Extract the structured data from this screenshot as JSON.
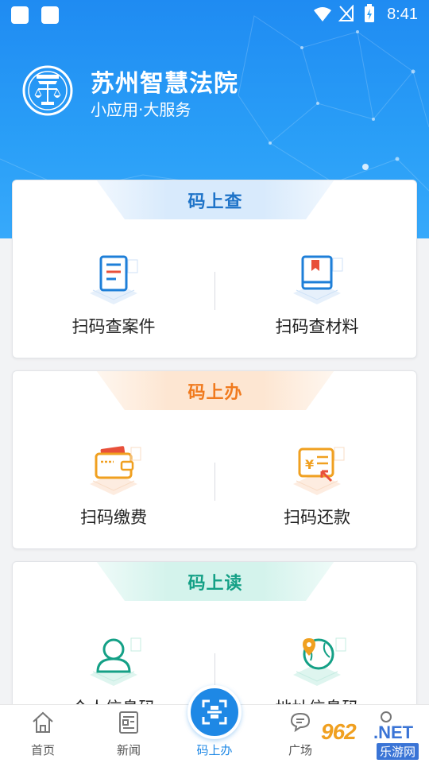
{
  "status_bar": {
    "time": "8:41"
  },
  "header": {
    "title": "苏州智慧法院",
    "subtitle": "小应用·大服务"
  },
  "sections": [
    {
      "title": "码上查",
      "items": [
        {
          "label": "扫码查案件",
          "icon": "document-icon"
        },
        {
          "label": "扫码查材料",
          "icon": "book-icon"
        }
      ]
    },
    {
      "title": "码上办",
      "items": [
        {
          "label": "扫码缴费",
          "icon": "wallet-icon"
        },
        {
          "label": "扫码还款",
          "icon": "yuan-card-icon"
        }
      ]
    },
    {
      "title": "码上读",
      "items": [
        {
          "label": "个人信息码",
          "icon": "person-icon"
        },
        {
          "label": "地址信息码",
          "icon": "globe-location-icon"
        }
      ]
    }
  ],
  "tabbar": {
    "items": [
      {
        "label": "首页",
        "icon": "home-icon"
      },
      {
        "label": "新闻",
        "icon": "news-icon"
      },
      {
        "label": "码上办",
        "icon": "scan-icon"
      },
      {
        "label": "广场",
        "icon": "chat-icon"
      }
    ]
  },
  "watermark": {
    "number": "962",
    "net": ".NET",
    "site": "乐游网"
  },
  "colors": {
    "primary": "#1e88e5",
    "blue_title": "#1e73c8",
    "orange_title": "#f07a1e",
    "green_title": "#14a086"
  }
}
